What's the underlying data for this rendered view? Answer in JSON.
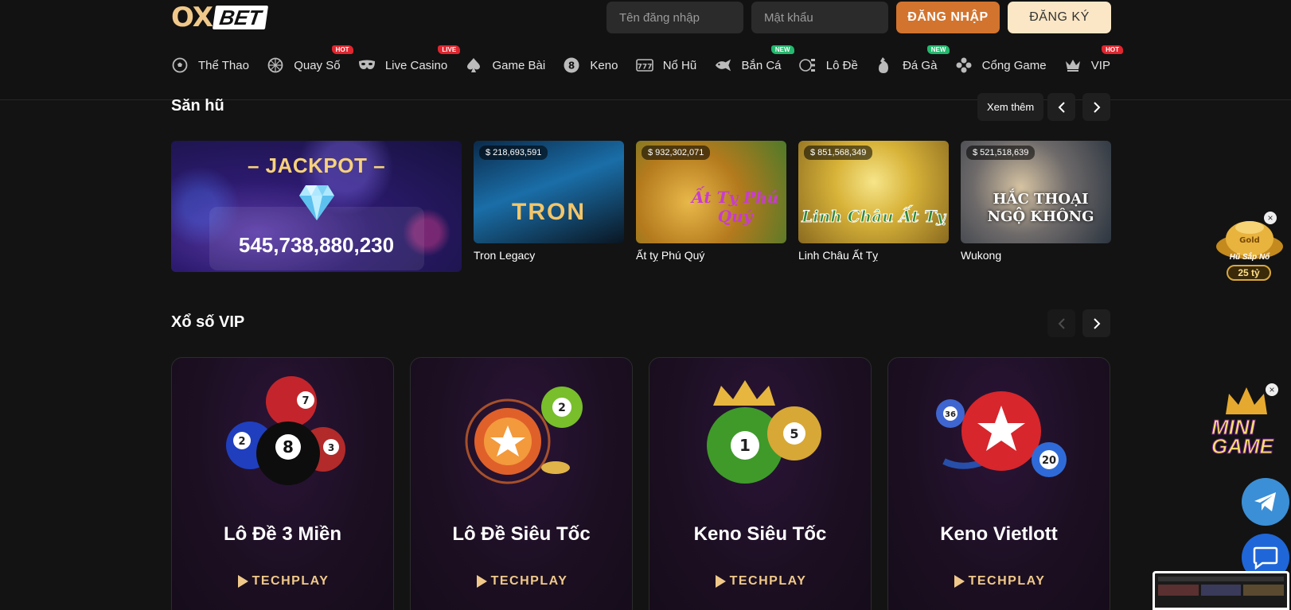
{
  "header": {
    "logo": {
      "part1": "OX",
      "part2": "BET"
    },
    "auth": {
      "username_placeholder": "Tên đăng nhập",
      "password_placeholder": "Mật khẩu",
      "login_label": "ĐĂNG NHẬP",
      "register_label": "ĐĂNG KÝ"
    },
    "nav": [
      {
        "label": "Thể Thao",
        "icon": "soccer-ball-icon",
        "badge": ""
      },
      {
        "label": "Quay Số",
        "icon": "lottery-ball-icon",
        "badge": "HOT"
      },
      {
        "label": "Live Casino",
        "icon": "mask-icon",
        "badge": "LIVE"
      },
      {
        "label": "Game Bài",
        "icon": "spade-icon",
        "badge": ""
      },
      {
        "label": "Keno",
        "icon": "eight-ball-icon",
        "badge": ""
      },
      {
        "label": "Nổ Hũ",
        "icon": "slot-777-icon",
        "badge": ""
      },
      {
        "label": "Bắn Cá",
        "icon": "fish-icon",
        "badge": "NEW"
      },
      {
        "label": "Lô Đề",
        "icon": "lotto-icon",
        "badge": ""
      },
      {
        "label": "Đá Gà",
        "icon": "rooster-icon",
        "badge": "NEW"
      },
      {
        "label": "Cổng Game",
        "icon": "gamepad-icon",
        "badge": ""
      },
      {
        "label": "VIP",
        "icon": "crown-icon",
        "badge": "HOT"
      }
    ]
  },
  "san_hu": {
    "title": "Săn hũ",
    "see_more": "Xem thêm",
    "jackpot": {
      "title": "– JACKPOT –",
      "amount": "545,738,880,230"
    },
    "games": [
      {
        "name": "Tron Legacy",
        "amount": "$ 218,693,591",
        "art": "TRON"
      },
      {
        "name": "Ất tỵ Phú Quý",
        "amount": "$ 932,302,071",
        "art": "Ất Tỵ Phú Quý"
      },
      {
        "name": "Linh Châu Ất Tỵ",
        "amount": "$ 851,568,349",
        "art": "Linh Châu Ất Tỵ"
      },
      {
        "name": "Wukong",
        "amount": "$ 521,518,639",
        "art": "HẮC THOẠI NGỘ KHÔNG"
      }
    ]
  },
  "xo_so_vip": {
    "title": "Xổ số VIP",
    "games": [
      {
        "name": "Lô Đề 3 Miền",
        "provider": "TECHPLAY"
      },
      {
        "name": "Lô Đề Siêu Tốc",
        "provider": "TECHPLAY"
      },
      {
        "name": "Keno Siêu Tốc",
        "provider": "TECHPLAY"
      },
      {
        "name": "Keno Vietlott",
        "provider": "TECHPLAY"
      }
    ]
  },
  "widgets": {
    "hu_sap_no": {
      "label": "Hũ Sắp Nổ",
      "value": "25 tỷ",
      "badge": "Gold"
    },
    "mini_game": {
      "label": "MINI GAME"
    }
  },
  "colors": {
    "accent_orange": "#d2742e",
    "register_cream": "#fbe7c6",
    "logo_gold": "#f0c98a",
    "badge_hot": "#e0262f",
    "badge_new": "#25b86e"
  }
}
